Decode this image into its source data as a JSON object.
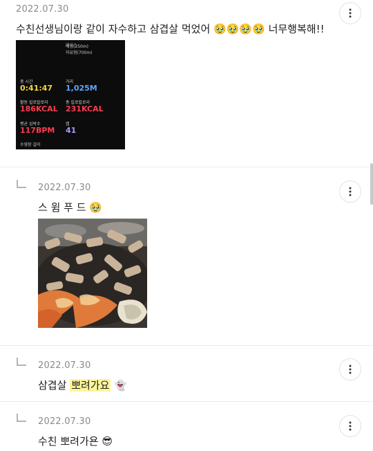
{
  "comments": [
    {
      "date": "2022.07.30",
      "text": "수친선생님이랑 같이 자수하고 삼겹살 먹었어",
      "emojis": "🥹🥹🥹🥹",
      "text_after": "너무행복해!!",
      "workout": {
        "pace_label": "페이스",
        "pace_value": "배영(250m)",
        "free_value": "자유형(700m)",
        "total_time_label": "총 시간",
        "total_time_value": "0:41:47",
        "distance_label": "거리",
        "distance_value": "1,025M",
        "active_cal_label": "활동 킬로칼로리",
        "active_cal_value": "186KCAL",
        "total_cal_label": "총 킬로칼로리",
        "total_cal_value": "231KCAL",
        "avg_hr_label": "평균 심박수",
        "avg_hr_value": "117BPM",
        "laps_label": "랩",
        "laps_value": "41",
        "pool_label": "수영장 길이"
      }
    },
    {
      "date": "2022.07.30",
      "text": "스 윔 푸 드",
      "emojis": "🥹"
    },
    {
      "date": "2022.07.30",
      "text": "삼겹살",
      "highlight": "뽀려가요",
      "emojis": "👻"
    },
    {
      "date": "2022.07.30",
      "text": "수친 뽀려가욘",
      "emojis": "😎"
    }
  ],
  "colors": {
    "time_yellow": "#f5d73a",
    "distance_blue": "#5aa8ff",
    "calorie_red": "#ff3b50",
    "laps_purple": "#a99cff",
    "highlight": "#fdf59a"
  }
}
